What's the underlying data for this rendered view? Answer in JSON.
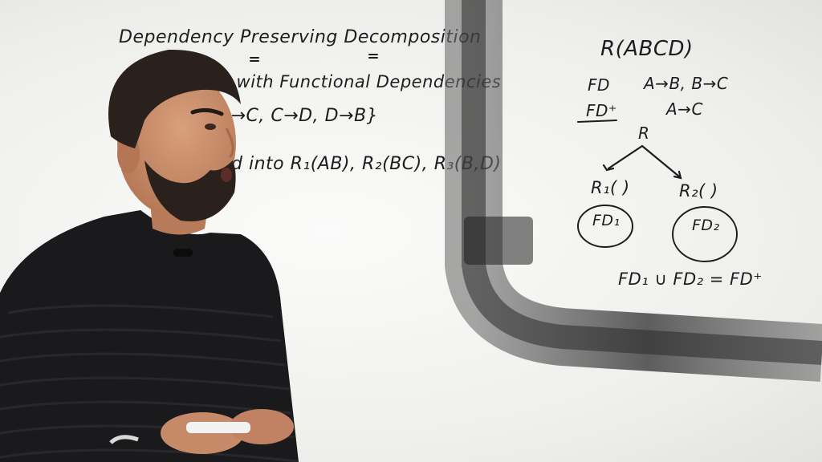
{
  "board": {
    "left": {
      "title": "Dependency Preserving Decomposition",
      "line1": "D) with Functional Dependencies",
      "line2": "B→C, C→D, D→B}",
      "line3": "sed into R₁(AB), R₂(BC), R₃(B,D)"
    },
    "right": {
      "relation": "R(ABCD)",
      "fd_label": "FD",
      "fd_value": "A→B, B→C",
      "fdplus_label": "FD⁺",
      "fdplus_value": "A→C",
      "root": "R",
      "r1": "R₁( )",
      "r2": "R₂(  )",
      "fd1": "FD₁",
      "fd2": "FD₂",
      "equation": "FD₁ ∪ FD₂ = FD⁺"
    }
  },
  "colors": {
    "board": "#f4f4f2",
    "marker": "#1d1d1d",
    "shirt": "#1a1a1c",
    "skin": "#c98b6a",
    "hair": "#2b211c",
    "mic_stand": "#3a3a3a"
  }
}
